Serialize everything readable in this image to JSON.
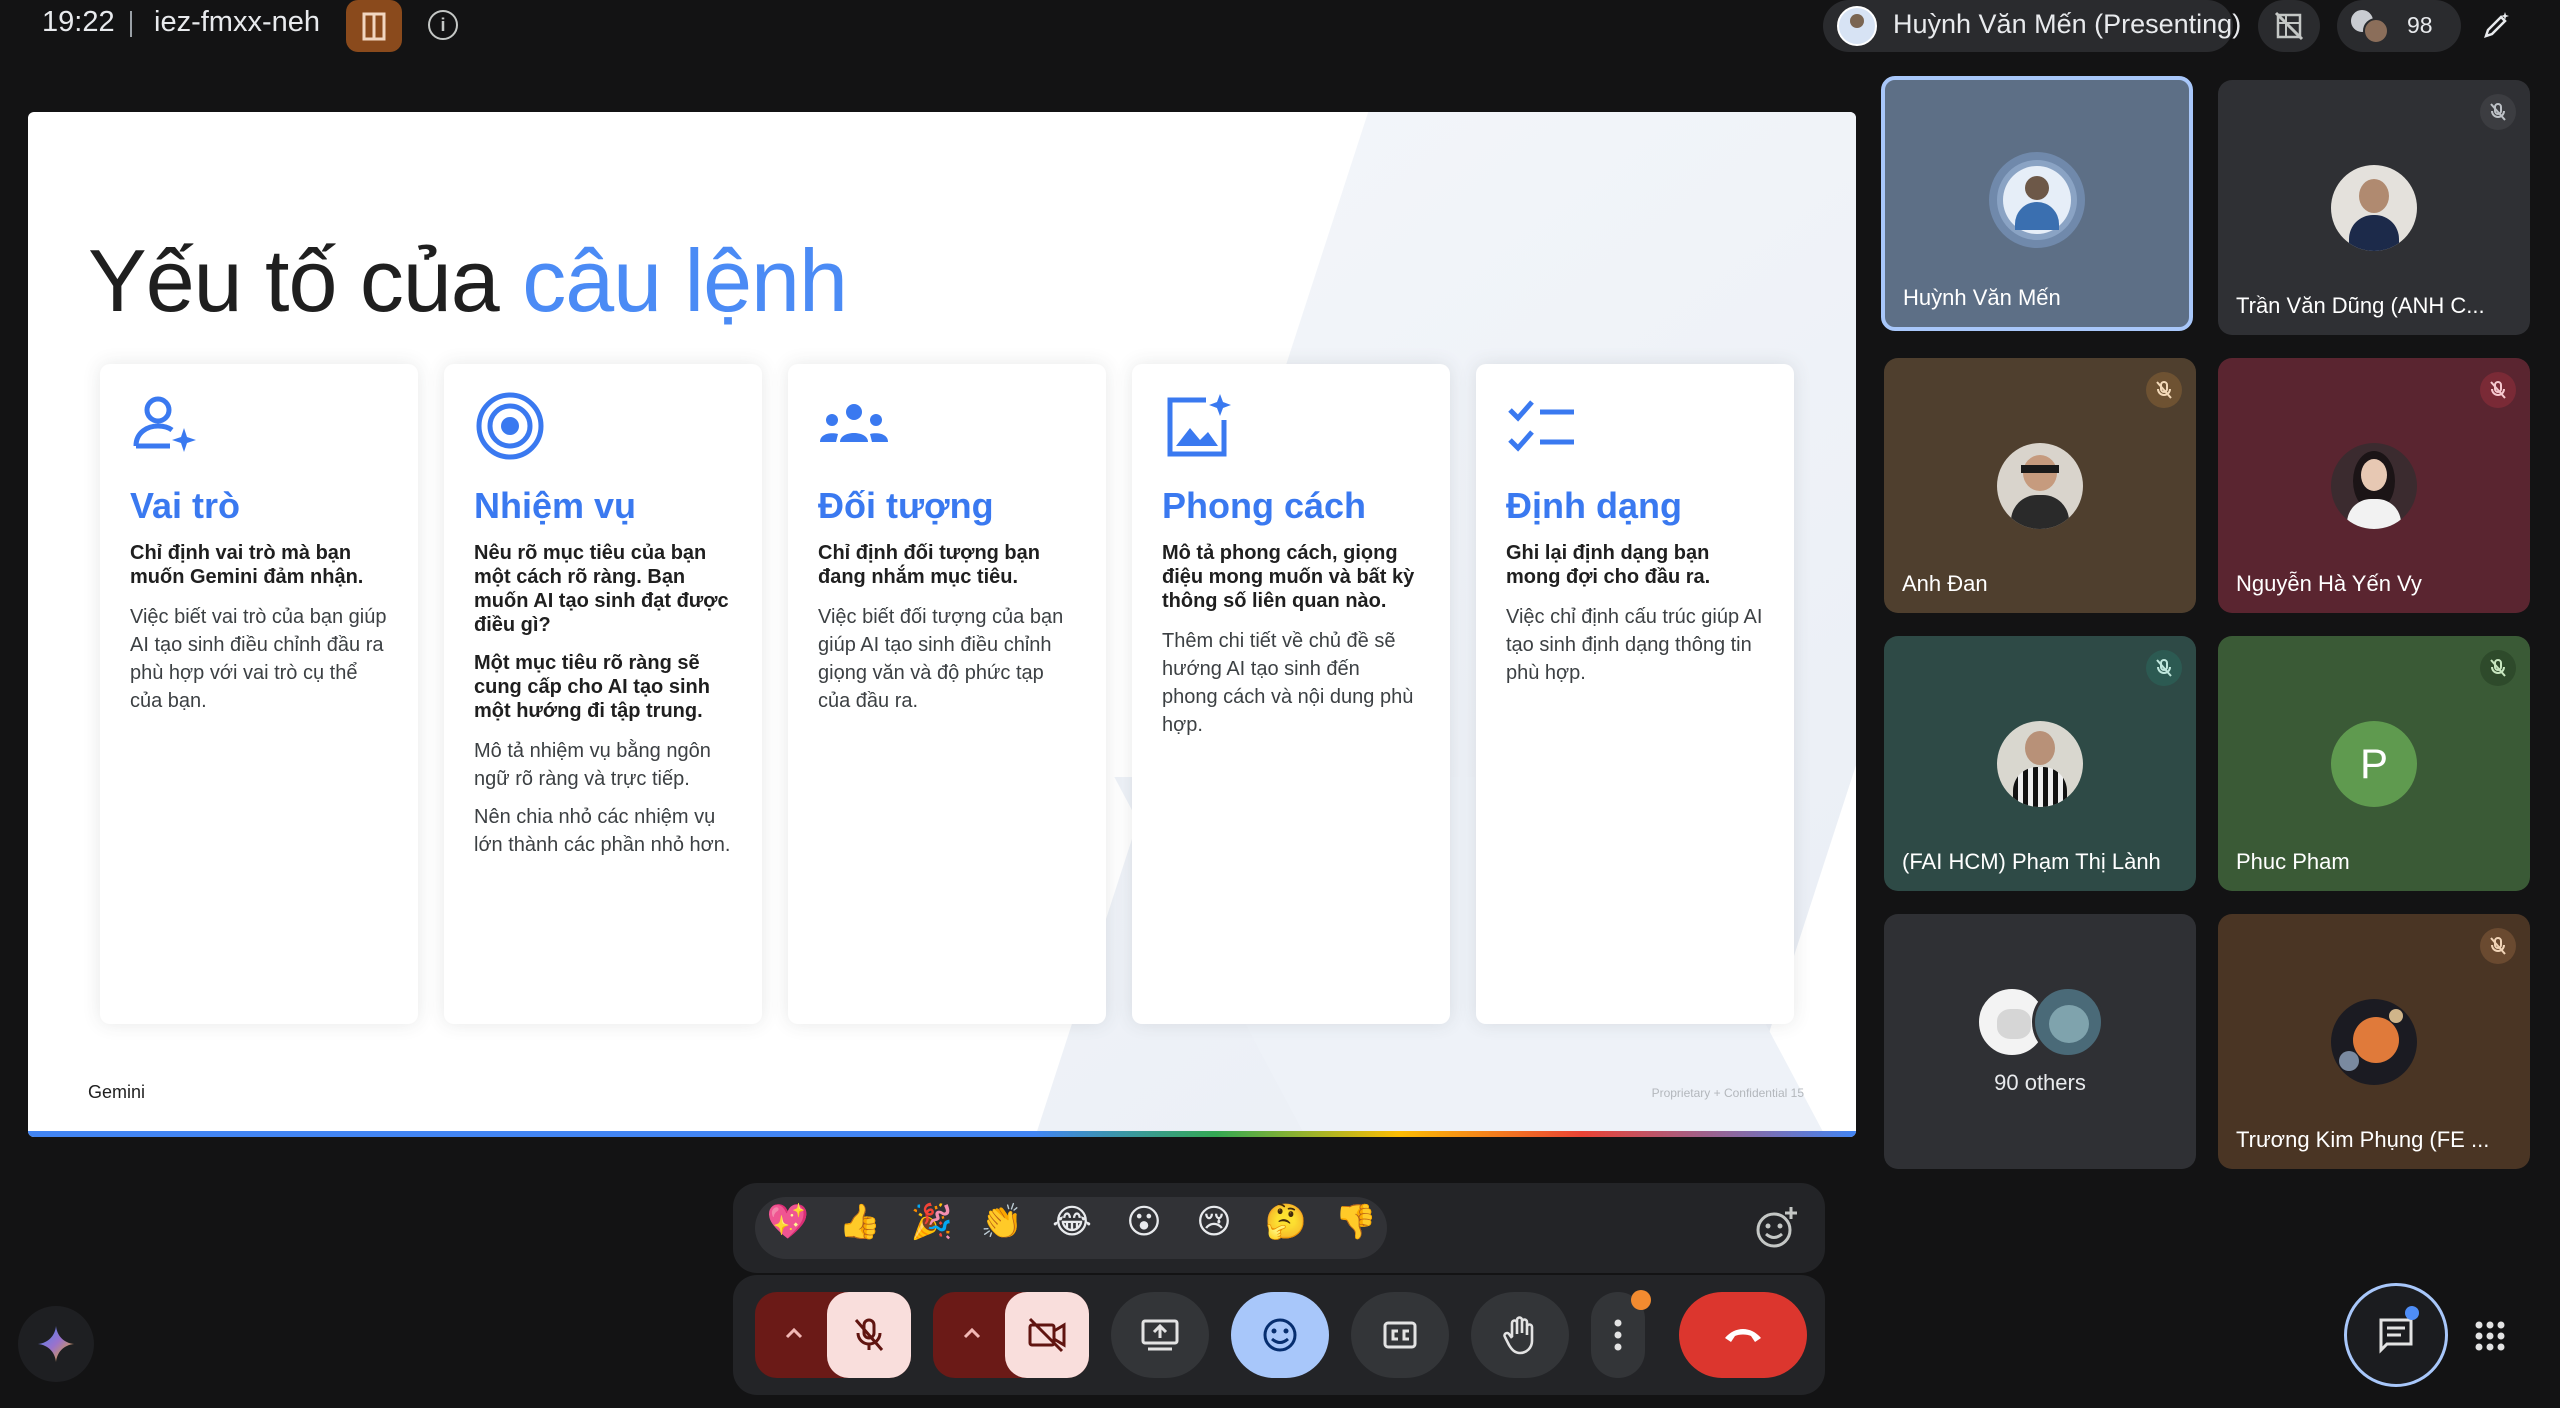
{
  "topbar": {
    "time": "19:22",
    "meeting_code": "iez-fmxx-neh",
    "presenter_label": "Huỳnh Văn Mến (Presenting)",
    "participant_count": "98"
  },
  "slide": {
    "title_main": "Yếu tố của ",
    "title_accent": "câu lệnh",
    "footer_brand": "Gemini",
    "footer_right": "Proprietary + Confidential   15",
    "cards": [
      {
        "heading": "Vai trò",
        "bold": [
          "Chỉ định vai trò mà bạn muốn Gemini đảm nhận."
        ],
        "normal": [
          "Việc biết vai trò của bạn giúp AI tạo sinh điều chỉnh đầu ra phù hợp với vai trò cụ thể của bạn."
        ]
      },
      {
        "heading": "Nhiệm vụ",
        "bold": [
          "Nêu rõ mục tiêu của bạn một cách rõ ràng. Bạn muốn AI tạo sinh đạt được điều gì?",
          "Một mục tiêu rõ ràng sẽ cung cấp cho AI tạo sinh một hướng đi tập trung."
        ],
        "normal": [
          "Mô tả nhiệm vụ bằng ngôn ngữ rõ ràng và trực tiếp.",
          "Nên chia nhỏ các nhiệm vụ lớn thành các phần nhỏ hơn."
        ]
      },
      {
        "heading": "Đối tượng",
        "bold": [
          "Chỉ định đối tượng bạn đang nhắm mục tiêu."
        ],
        "normal": [
          "Việc biết đối tượng của bạn giúp AI tạo sinh điều chỉnh giọng văn và độ phức tạp của đầu ra."
        ]
      },
      {
        "heading": "Phong cách",
        "bold": [
          "Mô tả phong cách, giọng điệu mong muốn và bất kỳ thông số liên quan nào."
        ],
        "normal": [
          "Thêm chi tiết về chủ đề sẽ hướng AI tạo sinh đến phong cách và nội dung phù hợp."
        ]
      },
      {
        "heading": "Định dạng",
        "bold": [
          "Ghi lại định dạng bạn mong đợi cho đầu ra."
        ],
        "normal": [
          "Việc chỉ định cấu trúc giúp AI tạo sinh định dạng thông tin phù hợp."
        ]
      }
    ]
  },
  "participants": [
    {
      "name": "Huỳnh Văn Mến",
      "muted": false,
      "bg": "#5d6f86"
    },
    {
      "name": "Trần Văn Dũng (ANH C...",
      "muted": true,
      "bg": "#2f3034"
    },
    {
      "name": "Anh Đan",
      "muted": true,
      "bg": "#4f3f2e"
    },
    {
      "name": "Nguyễn Hà Yến Vy",
      "muted": true,
      "bg": "#5a2530"
    },
    {
      "name": "(FAI HCM) Phạm Thị Lành",
      "muted": true,
      "bg": "#2e4a46"
    },
    {
      "name": "Phuc Pham",
      "initial": "P",
      "muted": true,
      "bg": "#3a5a36"
    },
    {
      "others": "90 others",
      "bg": "#2f3034"
    },
    {
      "name": "Trương Kim Phụng (FE ...",
      "muted": true,
      "bg": "#4a3524"
    }
  ],
  "reactions": [
    "💖",
    "👍",
    "🎉",
    "👏",
    "😂",
    "😮",
    "😢",
    "🤔",
    "👎"
  ],
  "colors": {
    "accent": "#4b8bf5",
    "end_call": "#dc362e",
    "active_control": "#a8c7fa",
    "muted_bg": "#6b1a17"
  }
}
